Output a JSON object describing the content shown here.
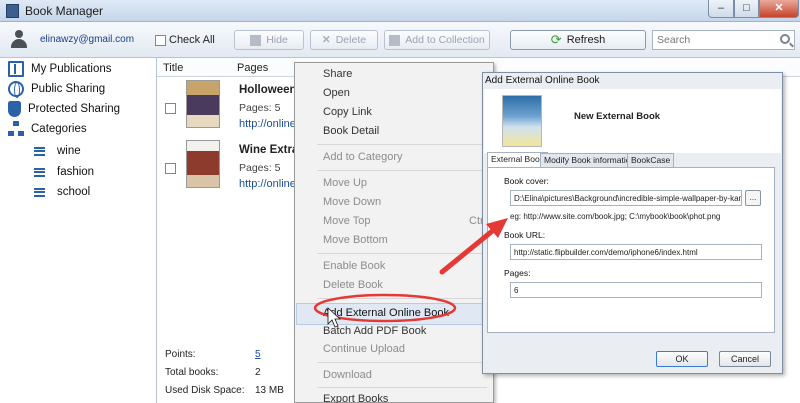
{
  "window": {
    "title": "Book Manager",
    "min": "–",
    "max": "□",
    "close": "✕"
  },
  "toolbar": {
    "email": "elinawzy@gmail.com",
    "check_all": "Check All",
    "hide": "Hide",
    "delete": "Delete",
    "add_to_collection": "Add to Collection",
    "refresh": "Refresh",
    "search_placeholder": "Search"
  },
  "sidebar": {
    "items": [
      {
        "label": "My Publications",
        "icon": "book-icon"
      },
      {
        "label": "Public Sharing",
        "icon": "globe-icon"
      },
      {
        "label": "Protected Sharing",
        "icon": "shield-icon"
      },
      {
        "label": "Categories",
        "icon": "category-tree-icon"
      }
    ],
    "categories": [
      "wine",
      "fashion",
      "school"
    ]
  },
  "table": {
    "columns": [
      "Title",
      "Pages"
    ],
    "rows": [
      {
        "title": "Holloween",
        "pages": "Pages: 5",
        "link": "http://online."
      },
      {
        "title": "Wine Extra",
        "pages": "Pages: 5",
        "link": "http://online."
      }
    ]
  },
  "stats": {
    "points_label": "Points:",
    "points": "5",
    "total_books_label": "Total books:",
    "total_books": "2",
    "disk_label": "Used Disk Space:",
    "disk": "13 MB"
  },
  "context_menu": {
    "share": "Share",
    "open": "Open",
    "copy_link": "Copy Link",
    "book_detail": "Book Detail",
    "add_to_category": "Add to Category",
    "move_up": "Move Up",
    "move_down": "Move Down",
    "move_top": "Move Top",
    "move_top_shortcut": "Ctrl+",
    "move_bottom": "Move Bottom",
    "enable_book": "Enable Book",
    "delete_book": "Delete Book",
    "add_external": "Add External Online Book",
    "batch_add_pdf": "Batch Add PDF Book",
    "continue_upload": "Continue Upload",
    "download": "Download",
    "export_books": "Export Books"
  },
  "dialog": {
    "title": "Add External Online Book",
    "book_name": "New External Book",
    "tabs": [
      "External Book",
      "Modify Book information",
      "BookCase"
    ],
    "cover_label": "Book cover:",
    "cover_path": "D:\\Elina\\pictures\\Background\\incredible-simple-wallpaper-by-kandiedar",
    "browse": "...",
    "hint": "eg: http://www.site.com/book.jpg; C:\\mybook\\book\\phot.png",
    "url_label": "Book URL:",
    "url_value": "http://static.flipbuilder.com/demo/iphone6/index.html",
    "pages_label": "Pages:",
    "pages_value": "6",
    "ok": "OK",
    "cancel": "Cancel"
  },
  "colors": {
    "accent": "#2a62a8",
    "highlight": "#e53935",
    "link": "#1b4f9c"
  }
}
